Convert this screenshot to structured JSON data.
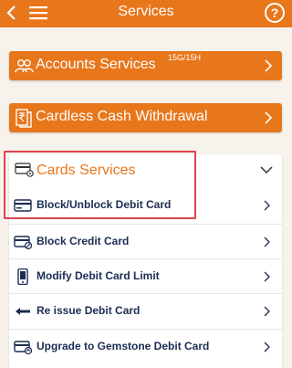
{
  "header": {
    "title": "Services",
    "help_label": "?"
  },
  "accounts": {
    "label": "Accounts Services",
    "tag": "15G/15H"
  },
  "cardless": {
    "label": "Cardless Cash Withdrawal"
  },
  "cards": {
    "label": "Cards Services",
    "items": [
      {
        "label": "Block/Unblock Debit Card"
      },
      {
        "label": "Block Credit Card"
      },
      {
        "label": "Modify Debit Card Limit"
      },
      {
        "label": "Re issue Debit Card"
      },
      {
        "label": "Upgrade to Gemstone Debit Card"
      }
    ]
  },
  "colors": {
    "accent": "#e8761b",
    "highlight": "#e0454f",
    "item_text": "#1c2c52"
  }
}
